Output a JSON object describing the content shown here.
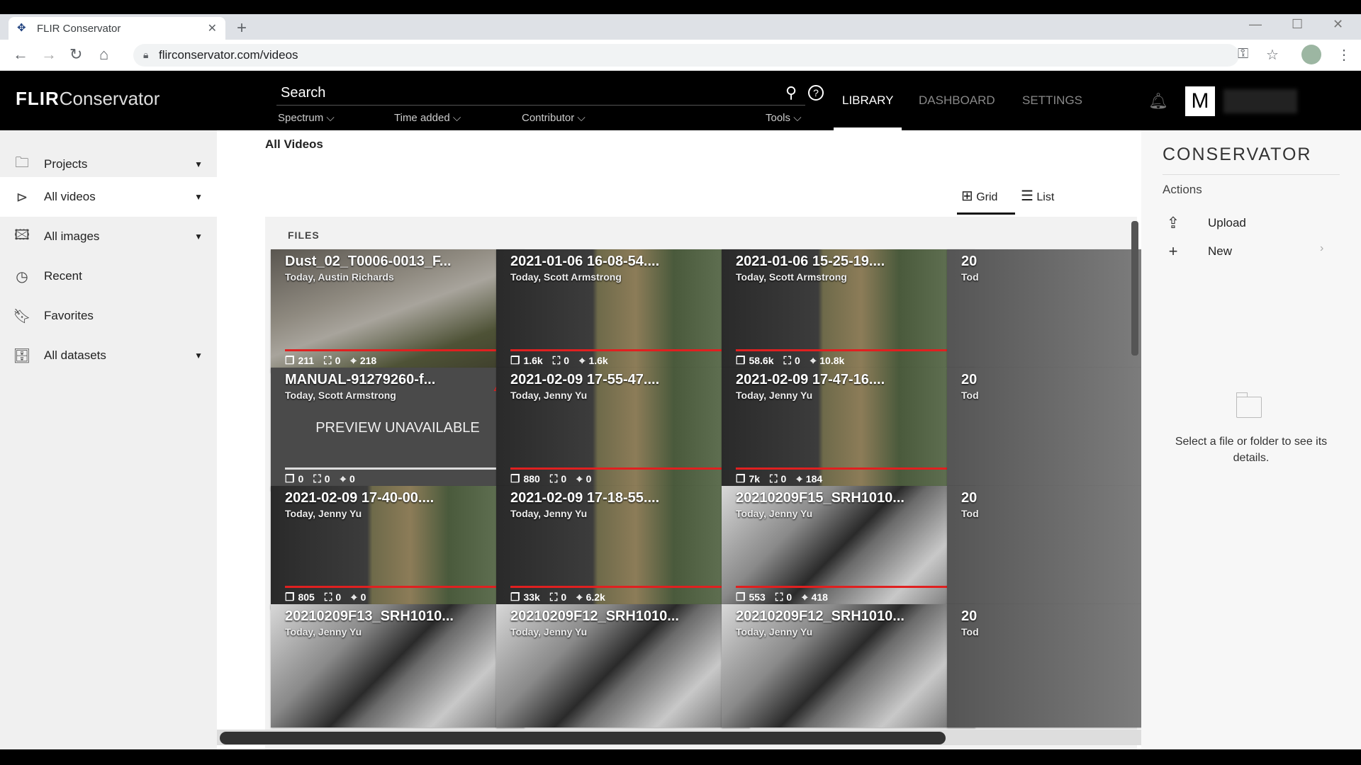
{
  "browser": {
    "tab_title": "FLIR Conservator",
    "url": "flirconservator.com/videos"
  },
  "header": {
    "logo_bold": "FLIR",
    "logo_rest": "Conservator",
    "search_label": "Search",
    "filters": [
      "Spectrum",
      "Time added",
      "Contributor",
      "Tools"
    ],
    "nav": {
      "library": "LIBRARY",
      "dashboard": "DASHBOARD",
      "settings": "SETTINGS"
    },
    "avatar_letter": "M"
  },
  "sidebar": {
    "items": [
      {
        "label": "Projects",
        "icon": "folder-icon",
        "has_caret": true
      },
      {
        "label": "All videos",
        "icon": "video-icon",
        "has_caret": true,
        "active": true
      },
      {
        "label": "All images",
        "icon": "image-icon",
        "has_caret": true
      },
      {
        "label": "Recent",
        "icon": "clock-icon",
        "has_caret": false
      },
      {
        "label": "Favorites",
        "icon": "bookmark-icon",
        "has_caret": false
      },
      {
        "label": "All datasets",
        "icon": "dataset-icon",
        "has_caret": true
      }
    ]
  },
  "main": {
    "title": "All Videos",
    "view_grid": "Grid",
    "view_list": "List",
    "files_header": "FILES",
    "cards": [
      {
        "title": "Dust_02_T0006-0013_F...",
        "sub": "Today, Austin Richards",
        "frames": "211",
        "annotations": "0",
        "detections": "218",
        "theme": "road"
      },
      {
        "title": "2021-01-06 16-08-54....",
        "sub": "Today, Scott Armstrong",
        "frames": "1.6k",
        "annotations": "0",
        "detections": "1.6k",
        "theme": "map"
      },
      {
        "title": "2021-01-06 15-25-19....",
        "sub": "Today, Scott Armstrong",
        "frames": "58.6k",
        "annotations": "0",
        "detections": "10.8k",
        "theme": "map"
      },
      {
        "title": "20",
        "sub": "Tod",
        "theme": "partial"
      },
      {
        "title": "MANUAL-91279260-f...",
        "sub": "Today, Scott Armstrong",
        "frames": "0",
        "annotations": "0",
        "detections": "0",
        "theme": "unavail",
        "preview_text": "PREVIEW UNAVAILABLE"
      },
      {
        "title": "2021-02-09 17-55-47....",
        "sub": "Today, Jenny Yu",
        "frames": "880",
        "annotations": "0",
        "detections": "0",
        "theme": "map"
      },
      {
        "title": "2021-02-09 17-47-16....",
        "sub": "Today, Jenny Yu",
        "frames": "7k",
        "annotations": "0",
        "detections": "184",
        "theme": "map"
      },
      {
        "title": "20",
        "sub": "Tod",
        "theme": "partial"
      },
      {
        "title": "2021-02-09 17-40-00....",
        "sub": "Today, Jenny Yu",
        "frames": "805",
        "annotations": "0",
        "detections": "0",
        "theme": "map"
      },
      {
        "title": "2021-02-09 17-18-55....",
        "sub": "Today, Jenny Yu",
        "frames": "33k",
        "annotations": "0",
        "detections": "6.2k",
        "theme": "map"
      },
      {
        "title": "20210209F15_SRH1010...",
        "sub": "Today, Jenny Yu",
        "frames": "553",
        "annotations": "0",
        "detections": "418",
        "theme": "thermal"
      },
      {
        "title": "20",
        "sub": "Tod",
        "theme": "partial"
      },
      {
        "title": "20210209F13_SRH1010...",
        "sub": "Today, Jenny Yu",
        "theme": "thermal"
      },
      {
        "title": "20210209F12_SRH1010...",
        "sub": "Today, Jenny Yu",
        "theme": "thermal"
      },
      {
        "title": "20210209F12_SRH1010...",
        "sub": "Today, Jenny Yu",
        "theme": "thermal"
      },
      {
        "title": "20",
        "sub": "Tod",
        "theme": "partial"
      }
    ]
  },
  "right_panel": {
    "title": "CONSERVATOR",
    "actions_label": "Actions",
    "upload": "Upload",
    "new": "New",
    "empty_message": "Select a file or folder to see its details."
  }
}
